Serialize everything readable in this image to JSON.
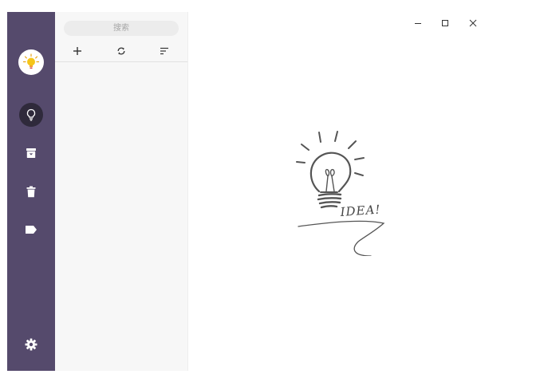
{
  "sidebar": {
    "avatar_icon": "lightbulb-sun-icon",
    "items": [
      {
        "name": "notes",
        "icon": "lightbulb-icon",
        "active": true
      },
      {
        "name": "archive",
        "icon": "archive-box-icon",
        "active": false
      },
      {
        "name": "trash",
        "icon": "trash-icon",
        "active": false
      },
      {
        "name": "tags",
        "icon": "tag-icon",
        "active": false
      }
    ],
    "settings_icon": "gear-icon"
  },
  "list": {
    "search_placeholder": "搜索",
    "toolbar": {
      "add_icon": "plus-icon",
      "sync_icon": "sync-icon",
      "sort_icon": "sort-icon"
    }
  },
  "window_controls": [
    "minimize-icon",
    "maximize-icon",
    "close-icon"
  ],
  "empty_state": {
    "illustration_text": "IDEA!"
  },
  "colors": {
    "sidebar_bg": "#554a6c",
    "sidebar_active": "#2f2a3b",
    "list_bg": "#f7f7f7",
    "accent_yellow": "#f5c518"
  }
}
